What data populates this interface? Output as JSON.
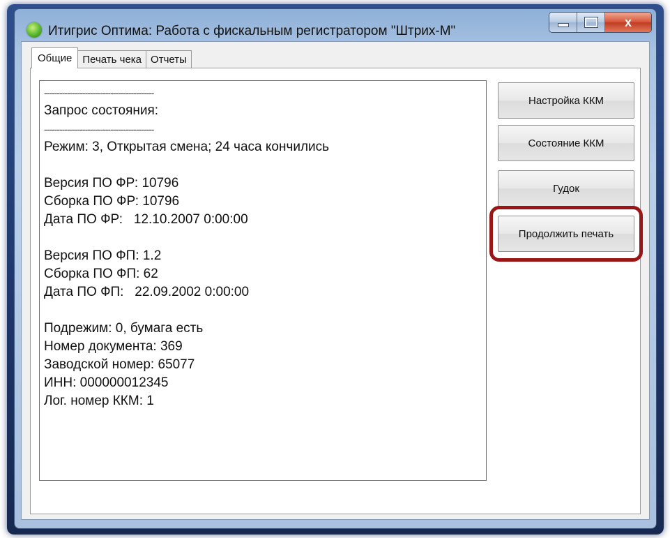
{
  "window": {
    "title": "Итигрис Оптима: Работа с фискальным регистратором \"Штрих-М\"",
    "controls": {
      "minimize": "",
      "maximize": "",
      "close": "x"
    }
  },
  "tabs": [
    {
      "label": "Общие",
      "active": true
    },
    {
      "label": "Печать чека",
      "active": false
    },
    {
      "label": "Отчеты",
      "active": false
    }
  ],
  "status_lines": [
    "-------------------------------------------",
    "Запрос состояния:",
    "-------------------------------------------",
    "Режим: 3, Открытая смена; 24 часа кончились",
    "",
    "Версия ПО ФР: 10796",
    "Сборка ПО ФР: 10796",
    "Дата ПО ФР:   12.10.2007 0:00:00",
    "",
    "Версия ПО ФП: 1.2",
    "Сборка ПО ФП: 62",
    "Дата ПО ФП:   22.09.2002 0:00:00",
    "",
    "Подрежим: 0, бумага есть",
    "Номер документа: 369",
    "Заводской номер: 65077",
    "ИНН: 000000012345",
    "Лог. номер ККМ: 1"
  ],
  "buttons": {
    "settings_kkm": "Настройка ККМ",
    "status_kkm": "Состояние ККМ",
    "beep": "Гудок",
    "continue_print": "Продолжить печать"
  },
  "highlight": {
    "target": "continue_print",
    "color": "#9a1616"
  }
}
